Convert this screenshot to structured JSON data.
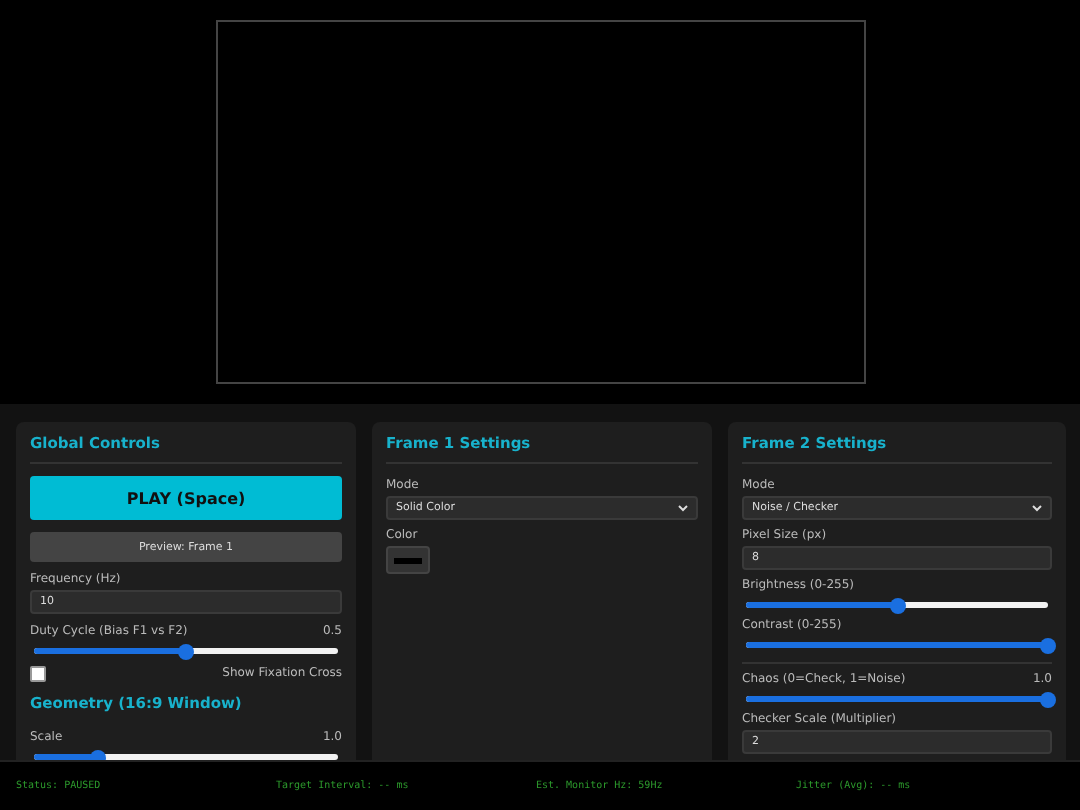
{
  "global_controls": {
    "title": "Global Controls",
    "play_button": "PLAY (Space)",
    "preview_button": "Preview: Frame 1",
    "frequency": {
      "label": "Frequency (Hz)",
      "value": "10"
    },
    "duty_cycle": {
      "label": "Duty Cycle (Bias F1 vs F2)",
      "reading": "0.5",
      "level": 0.5
    },
    "fixation_cross": {
      "label": "Show Fixation Cross",
      "checked": false
    },
    "geometry": {
      "title": "Geometry (16:9 Window)",
      "scale": {
        "label": "Scale",
        "reading": "1.0",
        "level": 0.21
      }
    }
  },
  "frame1": {
    "title": "Frame 1 Settings",
    "mode": {
      "label": "Mode",
      "value": "Solid Color"
    },
    "color": {
      "label": "Color",
      "color": "#000000"
    }
  },
  "frame2": {
    "title": "Frame 2 Settings",
    "mode": {
      "label": "Mode",
      "value": "Noise / Checker"
    },
    "pixel_size": {
      "label": "Pixel Size (px)",
      "value": "8"
    },
    "brightness": {
      "label": "Brightness (0-255)",
      "level": 0.5
    },
    "contrast": {
      "label": "Contrast (0-255)",
      "level": 1
    },
    "chaos": {
      "label": "Chaos (0=Check, 1=Noise)",
      "reading": "1.0",
      "level": 1
    },
    "checker_scale": {
      "label": "Checker Scale (Multiplier)",
      "value": "2"
    }
  },
  "status_bar": [
    "Status: PAUSED",
    "Target Interval: -- ms",
    "Est. Monitor Hz: 59Hz",
    "Jitter (Avg): -- ms"
  ]
}
